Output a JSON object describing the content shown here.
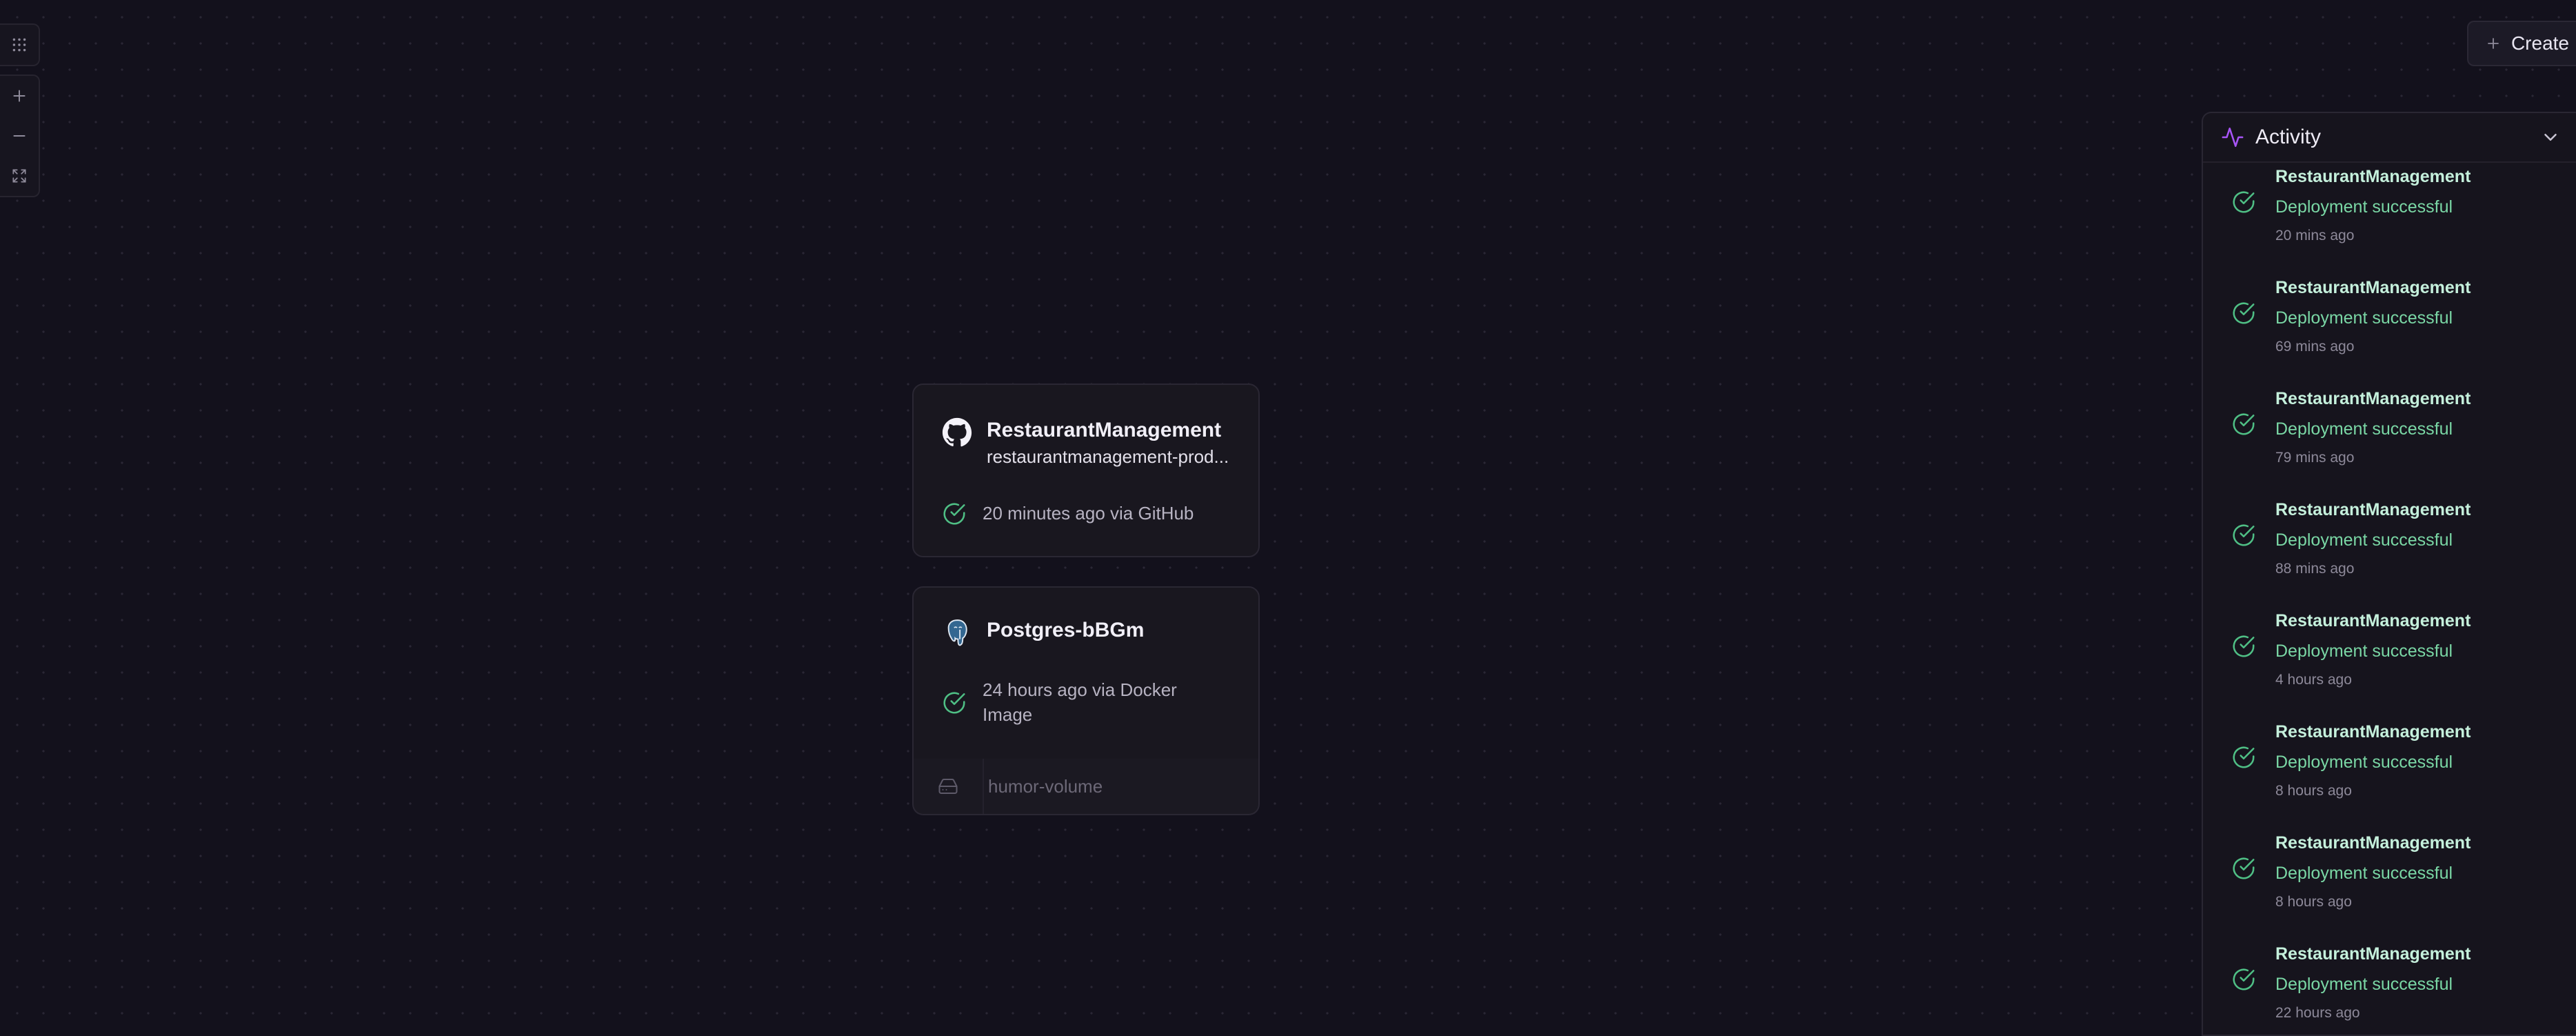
{
  "toolbar": {
    "create_label": "Create"
  },
  "services": [
    {
      "title": "RestaurantManagement",
      "subtitle": "restaurantmanagement-prod...",
      "status": "20 minutes ago via GitHub",
      "icon": "github-icon"
    },
    {
      "title": "Postgres-bBGm",
      "status": "24 hours ago via Docker Image",
      "icon": "postgres-icon",
      "volume": "humor-volume"
    }
  ],
  "activity": {
    "title": "Activity",
    "items": [
      {
        "service": "RestaurantManagement",
        "message": "Deployment successful",
        "time": "20 mins ago"
      },
      {
        "service": "RestaurantManagement",
        "message": "Deployment successful",
        "time": "69 mins ago"
      },
      {
        "service": "RestaurantManagement",
        "message": "Deployment successful",
        "time": "79 mins ago"
      },
      {
        "service": "RestaurantManagement",
        "message": "Deployment successful",
        "time": "88 mins ago"
      },
      {
        "service": "RestaurantManagement",
        "message": "Deployment successful",
        "time": "4 hours ago"
      },
      {
        "service": "RestaurantManagement",
        "message": "Deployment successful",
        "time": "8 hours ago"
      },
      {
        "service": "RestaurantManagement",
        "message": "Deployment successful",
        "time": "8 hours ago"
      },
      {
        "service": "RestaurantManagement",
        "message": "Deployment successful",
        "time": "22 hours ago"
      }
    ]
  },
  "colors": {
    "background": "#13111c",
    "success": "#7ad7a5",
    "accent": "#a855f7"
  }
}
